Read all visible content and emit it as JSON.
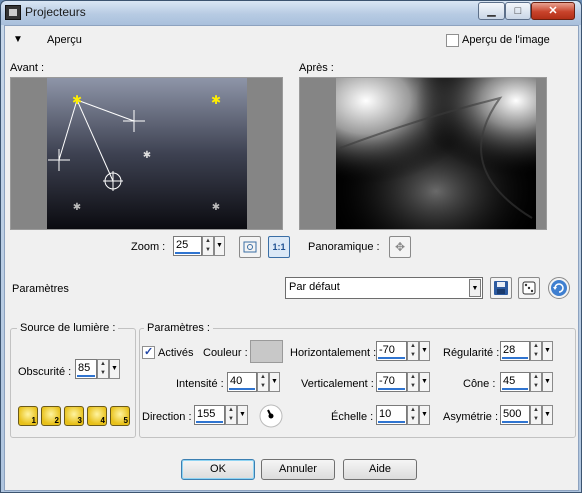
{
  "window": {
    "title": "Projecteurs"
  },
  "header": {
    "apercu_toggle": "▼",
    "apercu_label": "Aperçu",
    "image_preview_label": "Aperçu de l'image",
    "image_preview_checked": false
  },
  "previews": {
    "before_label": "Avant :",
    "after_label": "Après :"
  },
  "zoom": {
    "label": "Zoom :",
    "value": "25",
    "pan_label": "Panoramique :",
    "fit_icon": "fit-window-icon",
    "actual_icon": "actual-size-icon",
    "actual_text": "1:1"
  },
  "presets": {
    "label": "Paramètres",
    "selected": "Par défaut",
    "save_icon": "save-icon",
    "random_icon": "dice-icon",
    "reset_icon": "undo-icon"
  },
  "light_source": {
    "title": "Source de lumière :",
    "darkness_label": "Obscurité :",
    "darkness_value": "85",
    "presets": [
      "1",
      "2",
      "3",
      "4",
      "5"
    ]
  },
  "params": {
    "title": "Paramètres :",
    "active_label": "Activés",
    "active_checked": true,
    "color_label": "Couleur :",
    "color_value": "#c8c8c8",
    "intensity_label": "Intensité :",
    "intensity_value": "40",
    "direction_label": "Direction :",
    "direction_value": "155",
    "horizontal_label": "Horizontalement :",
    "horizontal_value": "-70",
    "vertical_label": "Verticalement :",
    "vertical_value": "-70",
    "scale_label": "Échelle :",
    "scale_value": "10",
    "regularity_label": "Régularité :",
    "regularity_value": "28",
    "cone_label": "Cône :",
    "cone_value": "45",
    "asymmetry_label": "Asymétrie :",
    "asymmetry_value": "500"
  },
  "buttons": {
    "ok": "OK",
    "cancel": "Annuler",
    "help": "Aide"
  }
}
